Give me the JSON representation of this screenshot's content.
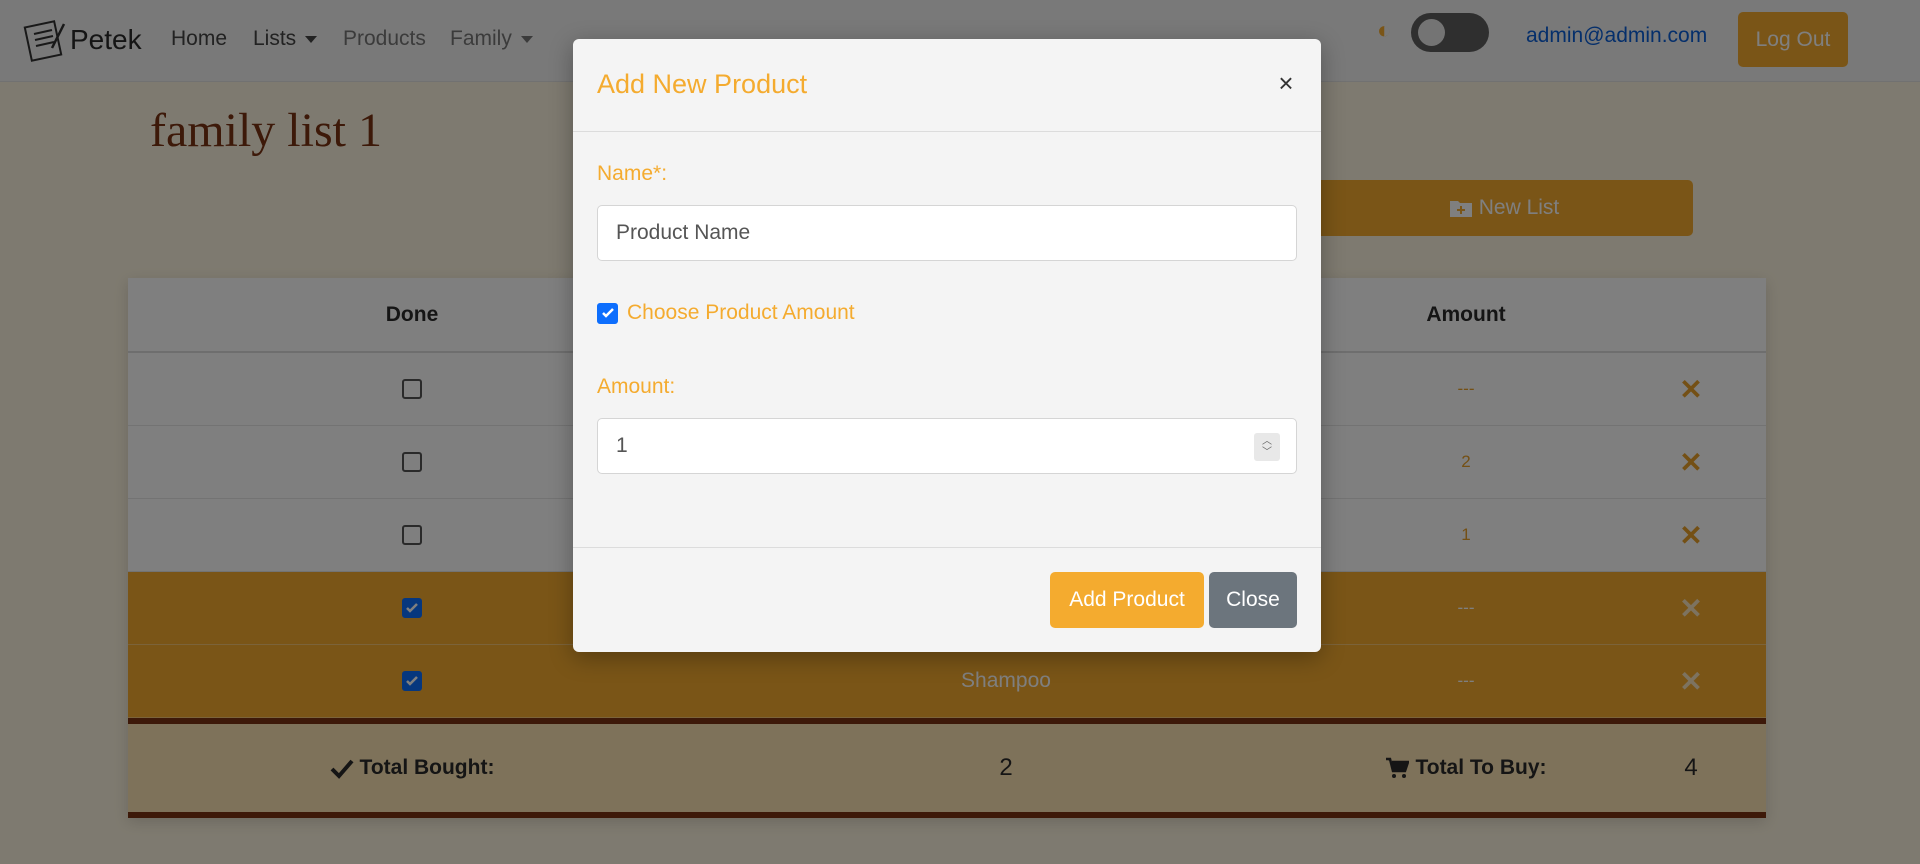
{
  "navbar": {
    "brand": "Petek",
    "links": [
      "Home",
      "Lists",
      "Products",
      "Family"
    ],
    "user_email": "admin@admin.com",
    "logout_label": "Log Out"
  },
  "page": {
    "title": "family list 1",
    "new_list_label": "New List"
  },
  "table": {
    "headers": {
      "done": "Done",
      "amount": "Amount"
    },
    "rows": [
      {
        "done": false,
        "name": "",
        "amount": "---"
      },
      {
        "done": false,
        "name": "",
        "amount": "2"
      },
      {
        "done": false,
        "name": "",
        "amount": "1"
      },
      {
        "done": true,
        "name": "",
        "amount": "---"
      },
      {
        "done": true,
        "name": "Shampoo",
        "amount": "---"
      }
    ],
    "summary": {
      "bought_label": "Total Bought:",
      "bought_value": "2",
      "to_buy_label": "Total To Buy:",
      "to_buy_value": "4"
    }
  },
  "modal": {
    "title": "Add New Product",
    "close_symbol": "×",
    "name_label": "Name*:",
    "name_placeholder": "Product Name",
    "choose_amount_label": "Choose Product Amount",
    "choose_amount_checked": true,
    "amount_label": "Amount:",
    "amount_value": "1",
    "add_button": "Add Product",
    "close_button": "Close"
  },
  "colors": {
    "accent": "#f4ab2f",
    "title": "#7a3312",
    "link": "#0b5ed7",
    "secondary": "#6c757d"
  }
}
